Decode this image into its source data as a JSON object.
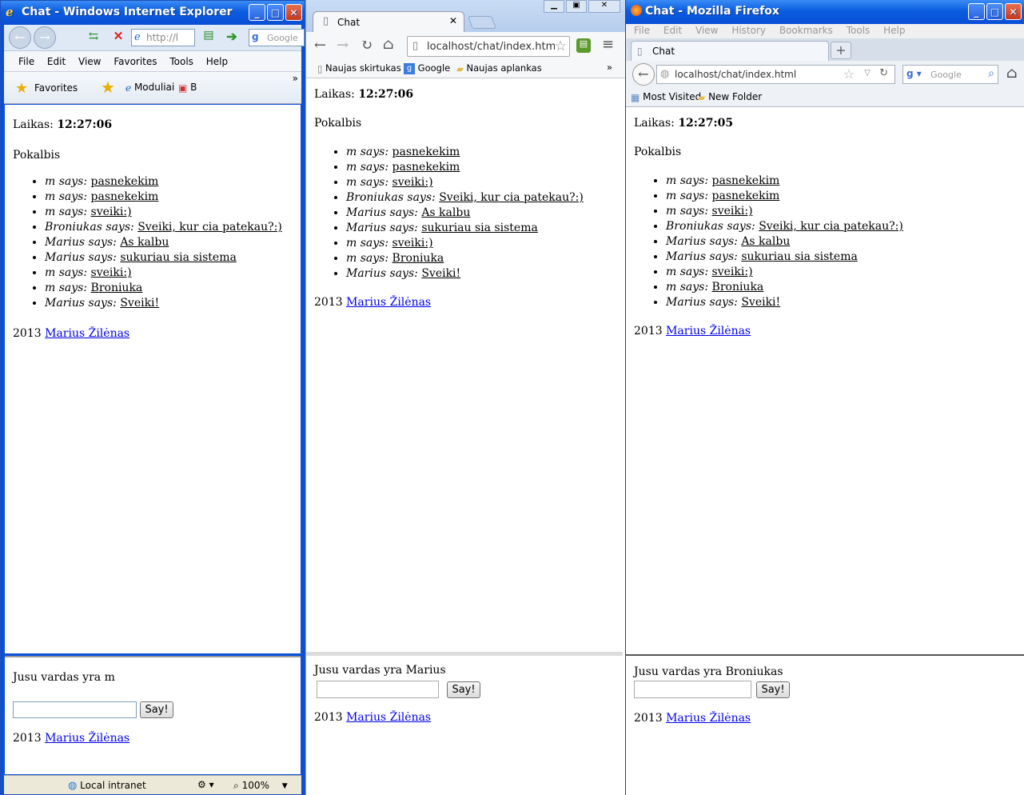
{
  "messages": [
    {
      "name": "m",
      "text": "pasnekekim"
    },
    {
      "name": "m",
      "text": "pasnekekim"
    },
    {
      "name": "m",
      "text": "sveiki:)"
    },
    {
      "name": "Broniukas",
      "text": "Sveiki, kur cia patekau?:)"
    },
    {
      "name": "Marius",
      "text": "As kalbu"
    },
    {
      "name": "Marius",
      "text": "sukuriau sia sistema"
    },
    {
      "name": "m",
      "text": "sveiki:)"
    },
    {
      "name": "m",
      "text": "Broniuka"
    },
    {
      "name": "Marius",
      "text": "Sveiki!"
    }
  ],
  "page": {
    "time_label": "Laikas:",
    "heading": "Pokalbis",
    "says": "says:",
    "footer_year": "2013",
    "footer_author": "Marius Žilėnas",
    "say_button": "Say!"
  },
  "ie": {
    "window_title": "Chat - Windows Internet Explorer",
    "address": "http://l",
    "search_placeholder": "Google",
    "menu": [
      "File",
      "Edit",
      "View",
      "Favorites",
      "Tools",
      "Help"
    ],
    "favorites_label": "Favorites",
    "fav_links": [
      "Moduliai",
      "B"
    ],
    "time": "12:27:06",
    "name_line": "Jusu vardas yra m",
    "status_zone": "Local intranet",
    "zoom": "100%"
  },
  "chrome": {
    "tab_title": "Chat",
    "address": "localhost/chat/index.htm",
    "bookmarks": [
      "Naujas skirtukas",
      "Google",
      "Naujas aplankas"
    ],
    "time": "12:27:06",
    "name_line": "Jusu vardas yra Marius"
  },
  "firefox": {
    "window_title": "Chat - Mozilla Firefox",
    "menu": [
      "File",
      "Edit",
      "View",
      "History",
      "Bookmarks",
      "Tools",
      "Help"
    ],
    "tab_title": "Chat",
    "address": "localhost/chat/index.html",
    "search_placeholder": "Google",
    "bookmarks": [
      "Most Visited",
      "New Folder"
    ],
    "time": "12:27:05",
    "name_line": "Jusu vardas yra Broniukas"
  }
}
